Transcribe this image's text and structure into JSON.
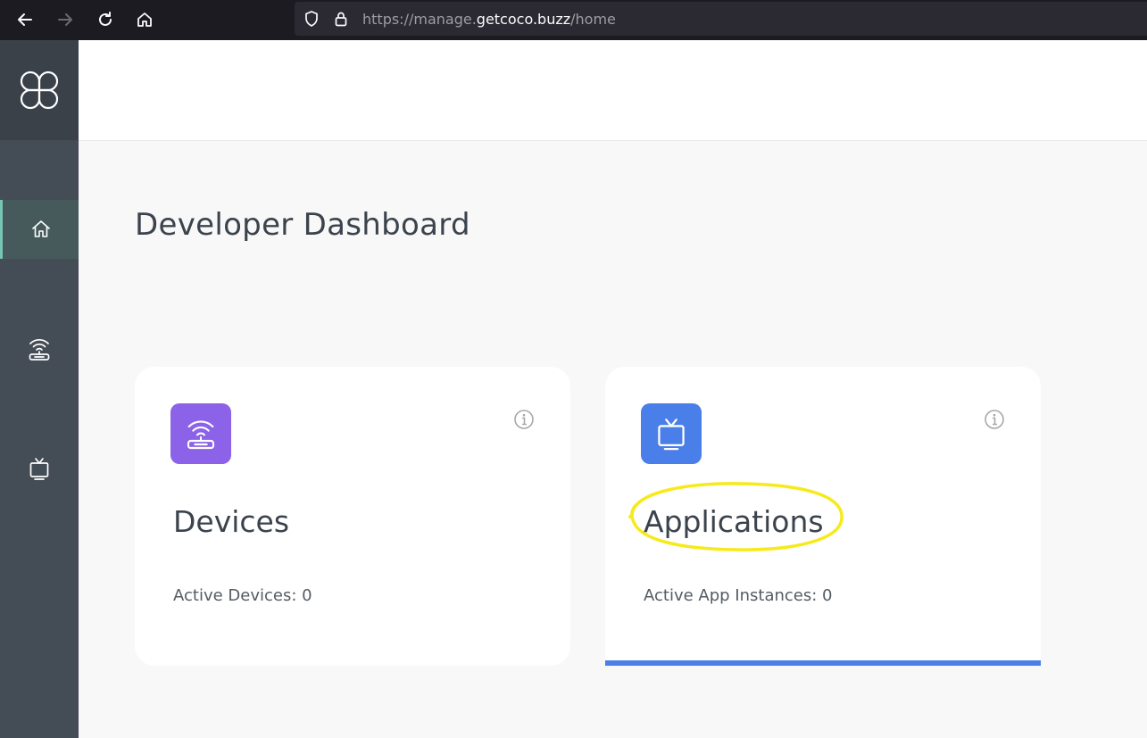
{
  "browser": {
    "url_prefix": "https://manage.",
    "url_domain": "getcoco.buzz",
    "url_path": "/home"
  },
  "sidebar": {
    "items": [
      {
        "icon": "home-icon",
        "active": true
      },
      {
        "icon": "router-icon",
        "active": false
      },
      {
        "icon": "tv-icon",
        "active": false
      }
    ]
  },
  "main": {
    "title": "Developer Dashboard",
    "cards": [
      {
        "title": "Devices",
        "subtitle": "Active Devices: 0",
        "icon": "router-icon",
        "icon_color": "#8b62e8"
      },
      {
        "title": "Applications",
        "subtitle": "Active App Instances: 0",
        "icon": "tv-icon",
        "icon_color": "#4a7ee8",
        "selected": true
      }
    ]
  },
  "colors": {
    "sidebar": "#444c56",
    "accent_teal": "#76c4b4",
    "purple": "#8b62e8",
    "blue": "#4a7ee8",
    "highlight_yellow": "#f7ea1a"
  }
}
